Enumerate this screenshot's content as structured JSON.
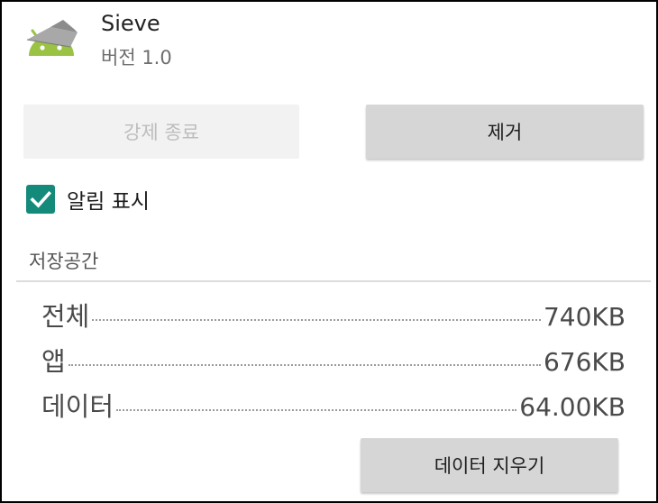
{
  "app": {
    "name": "Sieve",
    "version": "버전 1.0",
    "icon": "android-sieve-icon",
    "icon_colors": {
      "body": "#9ac243",
      "hat": "#a8a8a8"
    }
  },
  "buttons": {
    "force_stop": "강제 종료",
    "uninstall": "제거",
    "clear_data": "데이터 지우기"
  },
  "notifications": {
    "label": "알림 표시",
    "checked": true,
    "accent": "#138a7a"
  },
  "storage": {
    "title": "저장공간",
    "rows": [
      {
        "label": "전체",
        "value": "740KB"
      },
      {
        "label": "앱",
        "value": "676KB"
      },
      {
        "label": "데이터",
        "value": "64.00KB"
      }
    ]
  }
}
